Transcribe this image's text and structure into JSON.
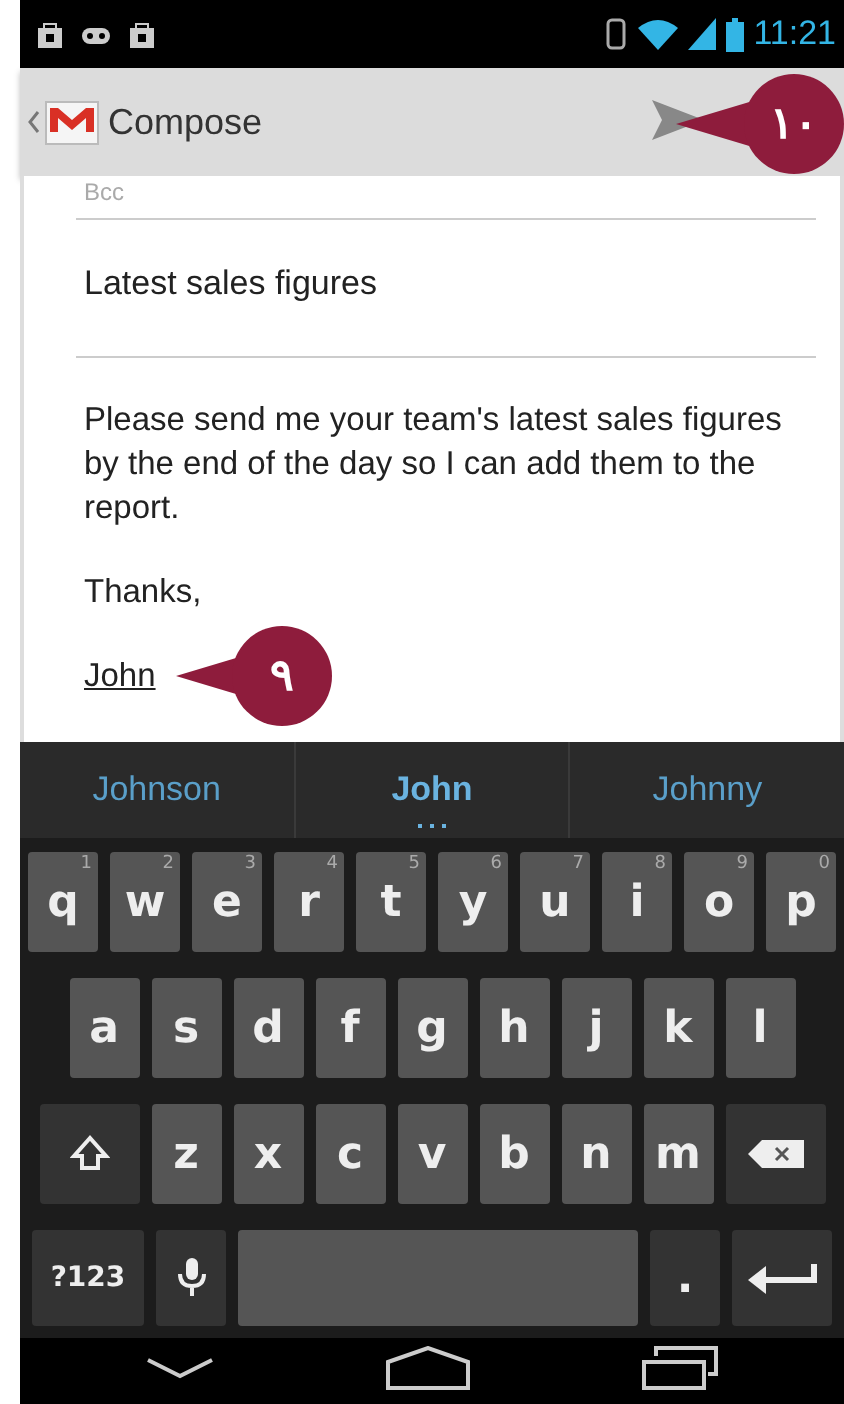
{
  "status_bar": {
    "time": "11:21"
  },
  "action_bar": {
    "title": "Compose"
  },
  "compose": {
    "bcc_label": "Bcc",
    "subject": "Latest sales figures",
    "body": "Please send me your team's latest sales figures by the end of the day so I can add them to the report.",
    "closing": "Thanks,",
    "signature": "John"
  },
  "suggestions": [
    {
      "text": "Johnson",
      "selected": false
    },
    {
      "text": "John",
      "selected": true
    },
    {
      "text": "Johnny",
      "selected": false
    }
  ],
  "keyboard": [
    {
      "keys": [
        {
          "kind": "letter",
          "label": "q",
          "hint": "1"
        },
        {
          "kind": "letter",
          "label": "w",
          "hint": "2"
        },
        {
          "kind": "letter",
          "label": "e",
          "hint": "3"
        },
        {
          "kind": "letter",
          "label": "r",
          "hint": "4"
        },
        {
          "kind": "letter",
          "label": "t",
          "hint": "5"
        },
        {
          "kind": "letter",
          "label": "y",
          "hint": "6"
        },
        {
          "kind": "letter",
          "label": "u",
          "hint": "7"
        },
        {
          "kind": "letter",
          "label": "i",
          "hint": "8"
        },
        {
          "kind": "letter",
          "label": "o",
          "hint": "9"
        },
        {
          "kind": "letter",
          "label": "p",
          "hint": "0"
        }
      ]
    },
    {
      "keys": [
        {
          "kind": "letter",
          "label": "a"
        },
        {
          "kind": "letter",
          "label": "s"
        },
        {
          "kind": "letter",
          "label": "d"
        },
        {
          "kind": "letter",
          "label": "f"
        },
        {
          "kind": "letter",
          "label": "g"
        },
        {
          "kind": "letter",
          "label": "h"
        },
        {
          "kind": "letter",
          "label": "j"
        },
        {
          "kind": "letter",
          "label": "k"
        },
        {
          "kind": "letter",
          "label": "l"
        }
      ]
    },
    {
      "keys": [
        {
          "kind": "shift"
        },
        {
          "kind": "letter",
          "label": "z"
        },
        {
          "kind": "letter",
          "label": "x"
        },
        {
          "kind": "letter",
          "label": "c"
        },
        {
          "kind": "letter",
          "label": "v"
        },
        {
          "kind": "letter",
          "label": "b"
        },
        {
          "kind": "letter",
          "label": "n"
        },
        {
          "kind": "letter",
          "label": "m"
        },
        {
          "kind": "backspace"
        }
      ]
    },
    {
      "keys": [
        {
          "kind": "symbols",
          "label": "?123"
        },
        {
          "kind": "mic"
        },
        {
          "kind": "space"
        },
        {
          "kind": "period",
          "label": "."
        },
        {
          "kind": "enter"
        }
      ]
    }
  ],
  "callouts": [
    {
      "number": "١٠"
    },
    {
      "number": "٩"
    }
  ]
}
